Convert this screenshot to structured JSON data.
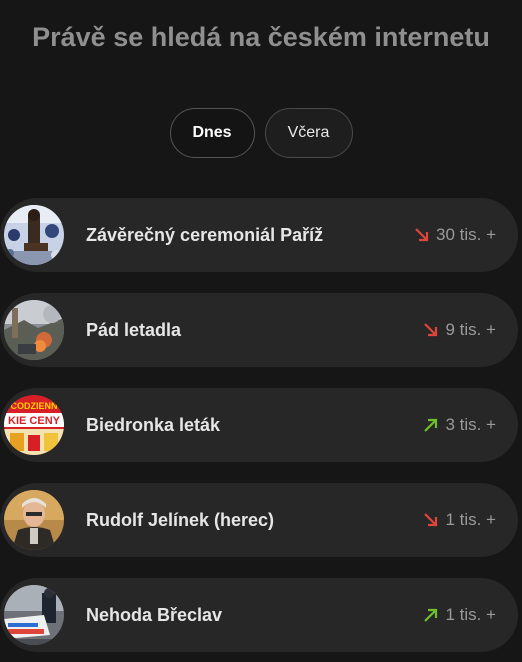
{
  "title": "Právě se hledá na českém internetu",
  "tabs": [
    {
      "label": "Dnes",
      "active": true
    },
    {
      "label": "Včera",
      "active": false
    }
  ],
  "colors": {
    "up": "#6fbf2a",
    "down": "#e0453a"
  },
  "items": [
    {
      "title": "Závěrečný ceremoniál Paříž",
      "count": "30 tis. +",
      "trend": "down",
      "thumb": "ceremony-image"
    },
    {
      "title": "Pád letadla",
      "count": "9 tis. +",
      "trend": "down",
      "thumb": "plane-crash-image"
    },
    {
      "title": "Biedronka leták",
      "count": "3 tis. +",
      "trend": "up",
      "thumb": "biedronka-flyer-image",
      "thumb_text": [
        "CODZIENN",
        "KIE CENY"
      ]
    },
    {
      "title": "Rudolf Jelínek (herec)",
      "count": "1 tis. +",
      "trend": "down",
      "thumb": "actor-portrait-image"
    },
    {
      "title": "Nehoda Břeclav",
      "count": "1 tis. +",
      "trend": "up",
      "thumb": "accident-image"
    }
  ]
}
